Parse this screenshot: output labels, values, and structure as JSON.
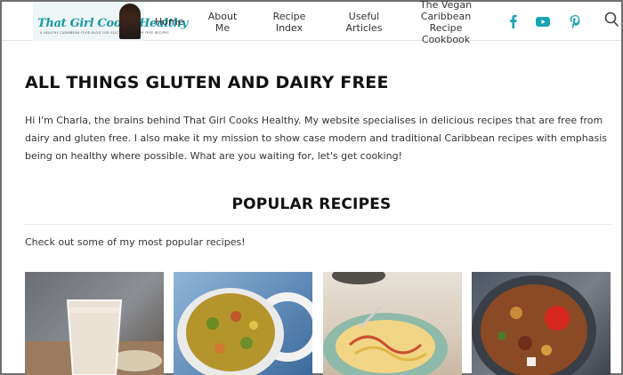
{
  "brand": {
    "name": "That Girl Cooks Healthy",
    "tagline": "A HEALTHY CARIBBEAN FOOD BLOG FOR GLUTEN AND DAIRY FREE RECIPES"
  },
  "nav": {
    "home": "Home",
    "about_1": "About",
    "about_2": "Me",
    "recipe_1": "Recipe",
    "recipe_2": "Index",
    "articles_1": "Useful",
    "articles_2": "Articles",
    "cookbook_1": "The Vegan",
    "cookbook_2": "Caribbean",
    "cookbook_3": "Recipe",
    "cookbook_4": "Cookbook"
  },
  "social": {
    "facebook_icon": "facebook-icon",
    "youtube_icon": "youtube-icon",
    "pinterest_icon": "pinterest-icon",
    "search_icon": "search-icon"
  },
  "colors": {
    "accent": "#1aa3b3"
  },
  "main": {
    "title": "ALL THINGS GLUTEN AND DAIRY FREE",
    "intro": "Hi I'm Charla, the brains behind That Girl Cooks Healthy. My website specialises in delicious recipes that are free from dairy and gluten free. I also make it my mission to show case modern and traditional Caribbean recipes with emphasis being on healthy where possible. What are you waiting for, let's get cooking!",
    "popular_title": "POPULAR RECIPES",
    "popular_sub": "Check out some of my most popular recipes!"
  }
}
